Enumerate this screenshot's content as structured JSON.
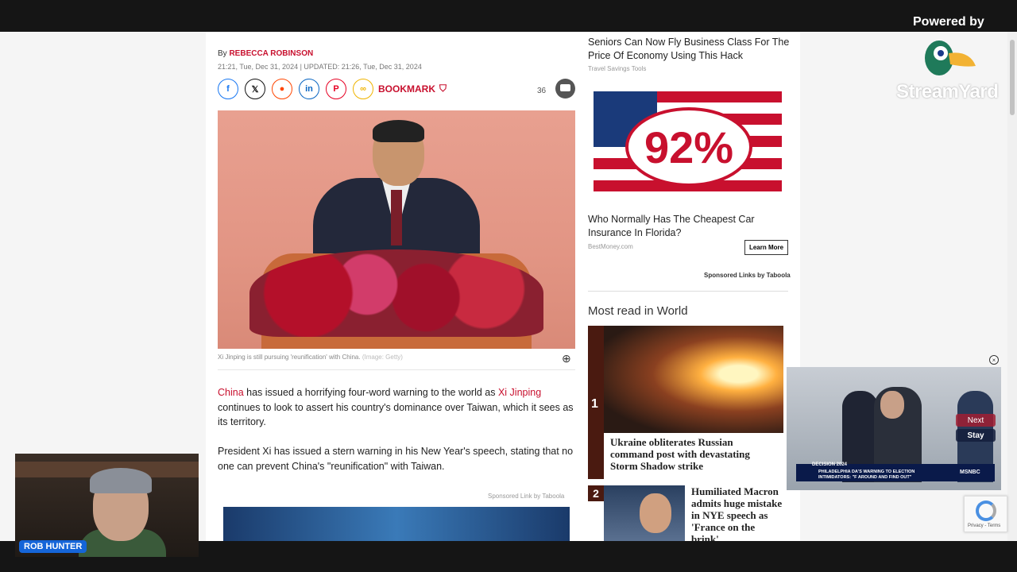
{
  "article": {
    "by_prefix": "By",
    "author": "REBECCA ROBINSON",
    "dateline": "21:21, Tue, Dec 31, 2024 | UPDATED: 21:26, Tue, Dec 31, 2024",
    "bookmark_label": "BOOKMARK",
    "comment_count": "36",
    "caption": "Xi Jinping is still pursuing 'reunification' with China.",
    "caption_credit": "(Image: Getty)",
    "para1_link1": "China",
    "para1_mid": " has issued a horrifying four-word warning to the world as ",
    "para1_link2": "Xi Jinping",
    "para1_end": " continues to look to assert his country's dominance over Taiwan, which it sees as its territory.",
    "para2": "President Xi has issued a stern warning in his New Year's speech, stating that no one can prevent China's \"reunification\" with Taiwan.",
    "sponsored_link": "Sponsored Link by Taboola"
  },
  "share": {
    "icons": [
      "facebook-icon",
      "x-icon",
      "reddit-icon",
      "linkedin-icon",
      "pinterest-icon",
      "link-icon"
    ],
    "colors": [
      "#1877f2",
      "#111111",
      "#ff4500",
      "#0a66c2",
      "#e60023",
      "#f0b400"
    ]
  },
  "sidebar": {
    "ad1_title": "Seniors Can Now Fly Business Class For The Price Of Economy Using This Hack",
    "ad1_source": "Travel Savings Tools",
    "ad2_image_text": "92%",
    "ad2_title": "Who Normally Has The Cheapest Car Insurance In Florida?",
    "ad2_source": "BestMoney.com",
    "learn_more": "Learn More",
    "taboola": "Sponsored Links by Taboola",
    "most_read_title": "Most read in World",
    "story1_num": "1",
    "story1_headline": "Ukraine obliterates Russian command post with devastating Storm Shadow strike",
    "story2_num": "2",
    "story2_headline": "Humiliated Macron admits huge mistake in NYE speech as 'France on the brink'"
  },
  "overlay": {
    "powered_by": "Powered by",
    "brand": "StreamYard",
    "presenter_name": "ROB HUNTER",
    "video_decision": "DECISION 2024",
    "video_chyron": "PHILADELPHIA DA'S WARNING TO ELECTION INTIMIDATORS: \"F AROUND AND FIND OUT\"",
    "video_network": "MSNBC",
    "next_label": "Next",
    "stay_label": "Stay",
    "recaptcha_text": "Privacy - Terms"
  }
}
